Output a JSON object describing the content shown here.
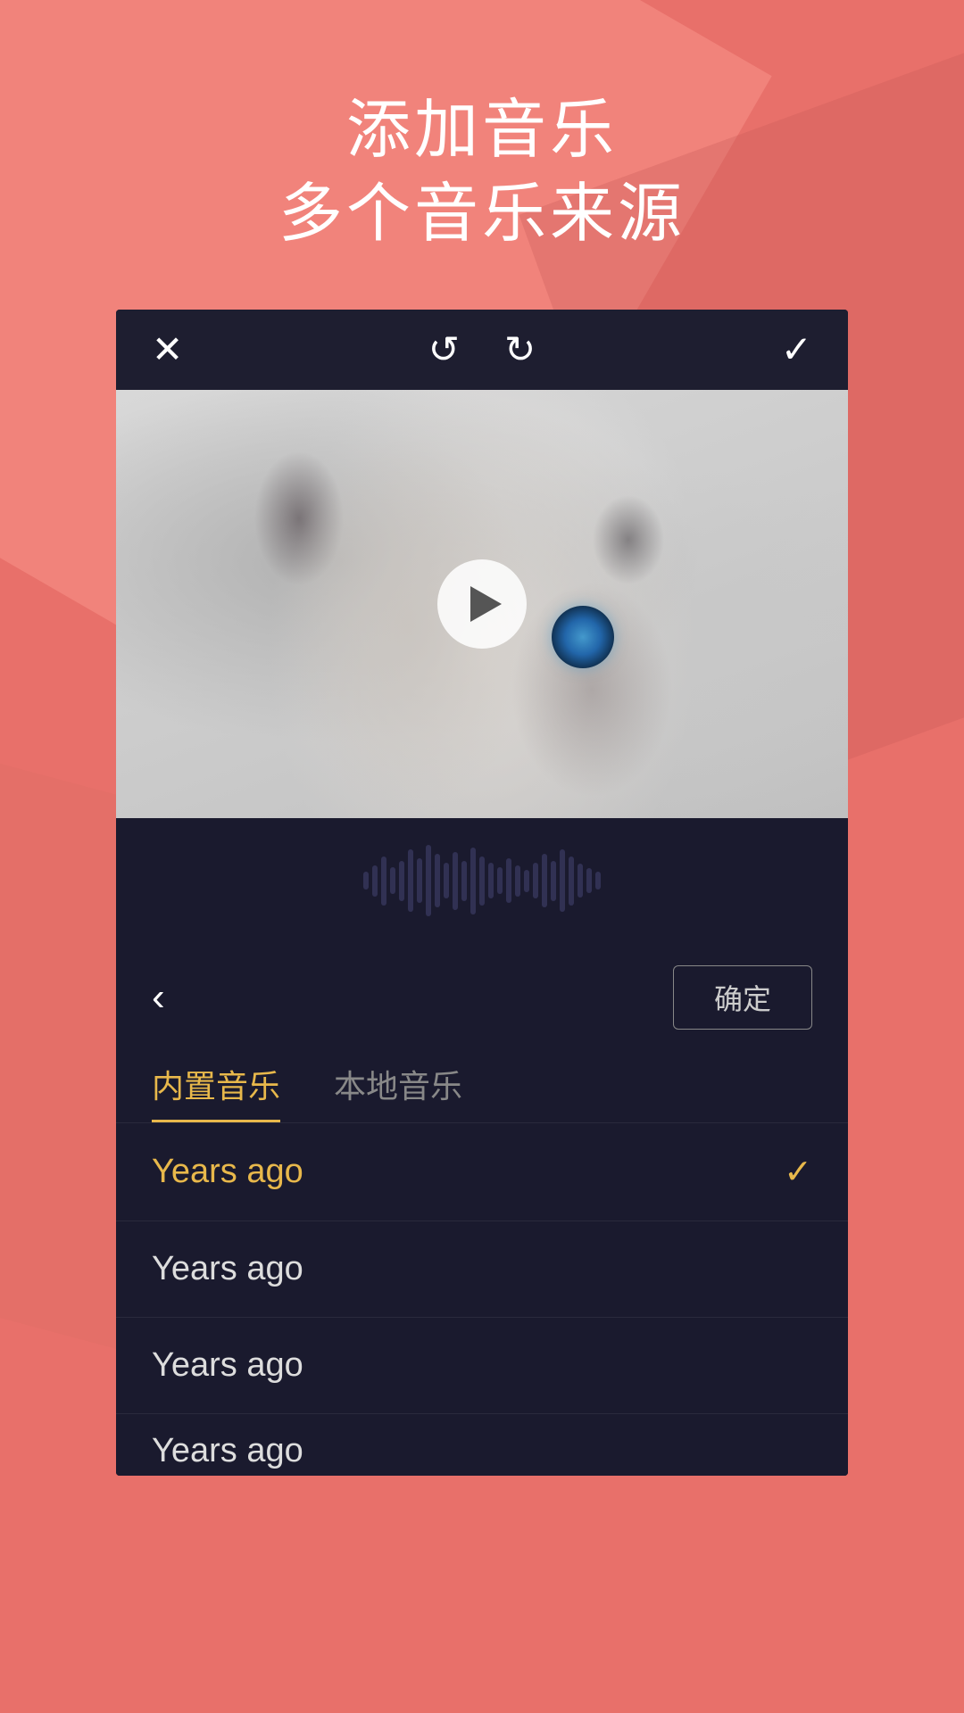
{
  "background": {
    "color": "#e8706a"
  },
  "header": {
    "title_line1": "添加音乐",
    "title_line2": "多个音乐来源"
  },
  "toolbar": {
    "close_label": "✕",
    "undo_label": "↺",
    "redo_label": "↻",
    "confirm_label": "✓"
  },
  "video": {
    "play_button_label": "▶"
  },
  "music_panel": {
    "back_label": "‹",
    "confirm_button_label": "确定",
    "tab_builtin_label": "内置音乐",
    "tab_local_label": "本地音乐"
  },
  "song_list": {
    "items": [
      {
        "name": "Years ago",
        "active": true
      },
      {
        "name": "Years ago",
        "active": false
      },
      {
        "name": "Years ago",
        "active": false
      },
      {
        "name": "Years ago",
        "active": false
      }
    ]
  },
  "colors": {
    "accent": "#e8b84b",
    "background_card": "#1a1a2e",
    "background_pink": "#e8706a",
    "text_white": "#ffffff",
    "text_gray": "#888888"
  }
}
